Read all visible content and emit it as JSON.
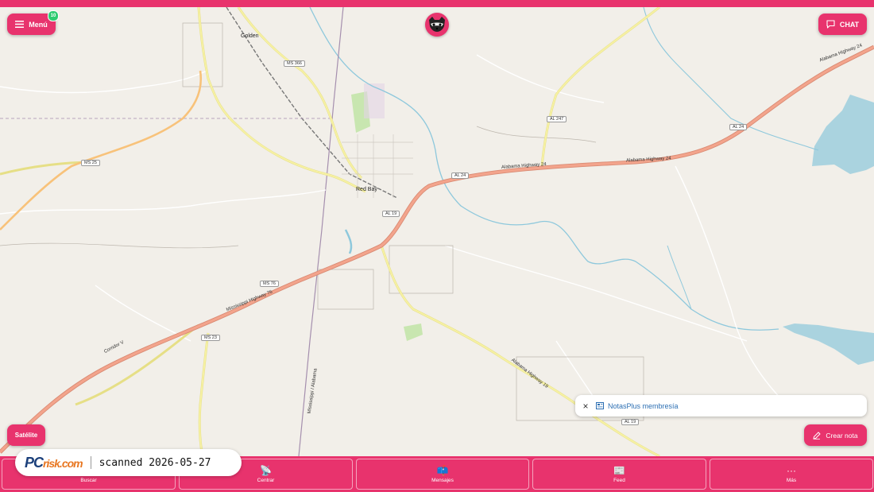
{
  "header": {
    "menu_label": "Menú",
    "menu_badge": "10",
    "chat_label": "CHAT"
  },
  "map": {
    "places": {
      "golden": "Golden",
      "red_bay": "Red Bay"
    },
    "shields": {
      "ms366": "MS 366",
      "ms25": "MS 25",
      "ms76": "MS 76",
      "ms23": "MS 23",
      "al247": "AL 247",
      "al24a": "AL 24",
      "al24b": "AL 24",
      "al19a": "AL 19",
      "al19b": "AL 19"
    },
    "road_labels": {
      "alabama_highway_24a": "Alabama Highway 24",
      "alabama_highway_24b": "Alabama Highway 24",
      "alabama_highway_24c": "Alabama Highway 24",
      "mississippi_highway_76": "Mississippi Highway 76",
      "corridor_v": "Corridor V",
      "natchez_trace": "Alabama Highway 19",
      "county_line": "Mississippi / Alabama"
    },
    "colors": {
      "land": "#f2efe9",
      "water": "#aad3df",
      "highway": "#e9967a",
      "secondary": "#f6f1a4",
      "parks": "#c8e6b0"
    }
  },
  "controls": {
    "satellite_label": "Satélite",
    "create_note_label": "Crear nota",
    "notas_label": "NotasPlus membresía"
  },
  "nav": {
    "buscar": "Buscar",
    "centrar": "Centrar",
    "mensajes": "Mensajes",
    "feed": "Feed",
    "mas": "Más"
  },
  "watermark": {
    "brand": "PC",
    "brand_suffix": "risk.com",
    "text": "scanned 2026-05-27"
  }
}
